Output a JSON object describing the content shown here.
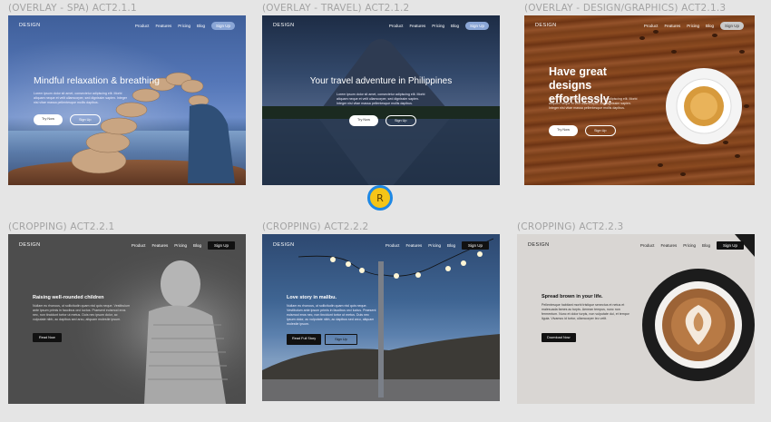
{
  "frames": [
    {
      "label": "(OVERLAY - SPA) ACT2.1.1",
      "logo": "DESIGN",
      "nav": [
        "Product",
        "Features",
        "Pricing",
        "Blog"
      ],
      "signup": "Sign Up",
      "title": "Mindful relaxation & breathing",
      "body": "Lorem ipsum dolor sit amet, consectetur adipiscing elit. Morbi aliquam neque et velit ullamcorper, sed dignissim sapien. Integer nisi vitae massa pellentesque mollis dapibus.",
      "btn1": "Try Now",
      "btn2": "Sign Up"
    },
    {
      "label": "(OVERLAY - TRAVEL) ACT2.1.2",
      "logo": "DESIGN",
      "nav": [
        "Product",
        "Features",
        "Pricing",
        "Blog"
      ],
      "signup": "Sign Up",
      "title": "Your travel adventure in Philippines",
      "body": "Lorem ipsum dolor sit amet, consectetur adipiscing elit. Morbi aliquam neque et velit ullamcorper, sed dignissim sapien. Integer nisi vitae massa pellentesque mollis dapibus.",
      "btn1": "Try Now",
      "btn2": "Sign Up"
    },
    {
      "label": "(OVERLAY - DESIGN/GRAPHICS) ACT2.1.3",
      "logo": "DESIGN",
      "nav": [
        "Product",
        "Features",
        "Pricing",
        "Blog"
      ],
      "signup": "Sign Up",
      "title": "Have great designs effortlessly.",
      "body": "Lorem ipsum dolor sit amet, consectetur adipiscing elit. Morbi aliquam neque et velit ullamcorper, sed dignissim sapien. Integer nisi vitae massa pellentesque mollis dapibus.",
      "btn1": "Try Now",
      "btn2": "Sign Up"
    },
    {
      "label": "(CROPPING) ACT2.2.1",
      "logo": "DESIGN",
      "nav": [
        "Product",
        "Features",
        "Pricing",
        "Blog"
      ],
      "signup": "Sign Up",
      "title": "Raising well-rounded children",
      "body": "Nullam eu rhoncus, ut sollicitudin quam nisl quis neque. Vestibulum ante ipsum primis in faucibus orci luctus. Praesent euismod eros nec, non tincidunt tortor ut metus. Duis nec ipsum dolor, ac vulputate nibh, ac dapibus sed arcu, aliquam molestie ipsum.",
      "btn1": "Read Now"
    },
    {
      "label": "(CROPPING) ACT2.2.2",
      "logo": "DESIGN",
      "nav": [
        "Product",
        "Features",
        "Pricing",
        "Blog"
      ],
      "signup": "Sign Up",
      "title": "Love story in malibu.",
      "body": "Nullam eu rhoncus, ut sollicitudin quam nisl quis neque. Vestibulum ante ipsum primis in faucibus orci luctus. Praesent euismod eros nec, non tincidunt tortor ut metus. Duis nec ipsum dolor, ac vulputate nibh, ac dapibus sed arcu, aliquam molestie ipsum.",
      "btn1": "Read Full Story",
      "btn2": "Sign Up"
    },
    {
      "label": "(CROPPING) ACT2.2.3",
      "logo": "DESIGN",
      "nav": [
        "Product",
        "Features",
        "Pricing",
        "Blog"
      ],
      "signup": "Sign Up",
      "title": "Spread brown in your life.",
      "body": "Pellentesque habitant morbi tristique senectus et netus et malesuada fames ac turpis. Aenean tempus, nunc non fermentum. Nunc et dolor turpis, non vulputate dui, et tempor ligula. Vivamus id tortor, ullamcorper leo velit.",
      "btn1": "Download Now"
    }
  ],
  "avatar": "R"
}
